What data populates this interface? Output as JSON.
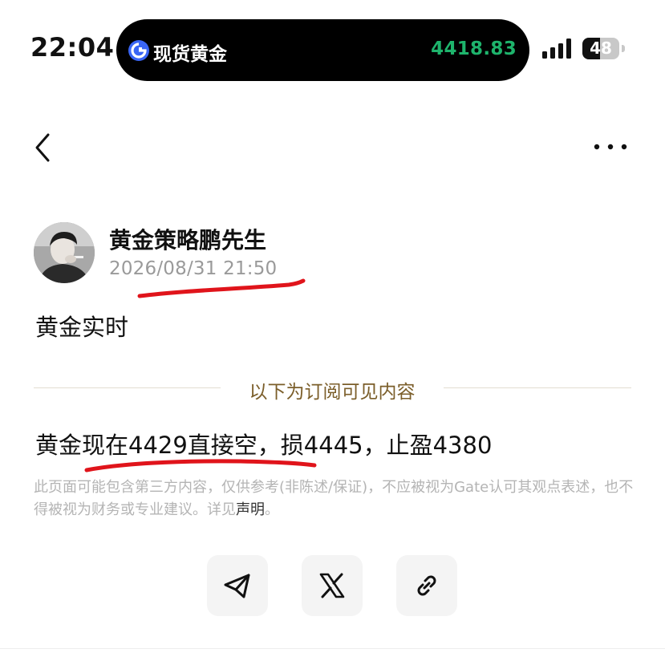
{
  "status_bar": {
    "time": "22:04",
    "ticker_label": "现货黄金",
    "ticker_price": "4418.83",
    "ticker_price_color": "#1eb46c",
    "battery_level": "48",
    "battery_fraction": 0.48
  },
  "nav": {
    "back_icon": "chevron-left-icon",
    "more_icon": "more-horizontal-icon"
  },
  "post": {
    "author_name": "黄金策略鹏先生",
    "timestamp": "2026/08/31 21:50",
    "title": "黄金实时",
    "subscriber_divider": "以下为订阅可见内容",
    "content": "黄金现在4429直接空，损4445，止盈4380",
    "disclaimer": "此页面可能包含第三方内容，仅供参考(非陈述/保证)，不应被视为Gate认可其观点表述，也不得被视为财务或专业建议。详见",
    "disclaimer_link": "声明",
    "disclaimer_end": "。"
  },
  "share": {
    "buttons": [
      "telegram-icon",
      "x-icon",
      "link-icon"
    ]
  },
  "colors": {
    "divider_text": "#7b5e2a",
    "annotation_red": "#e0141b"
  }
}
